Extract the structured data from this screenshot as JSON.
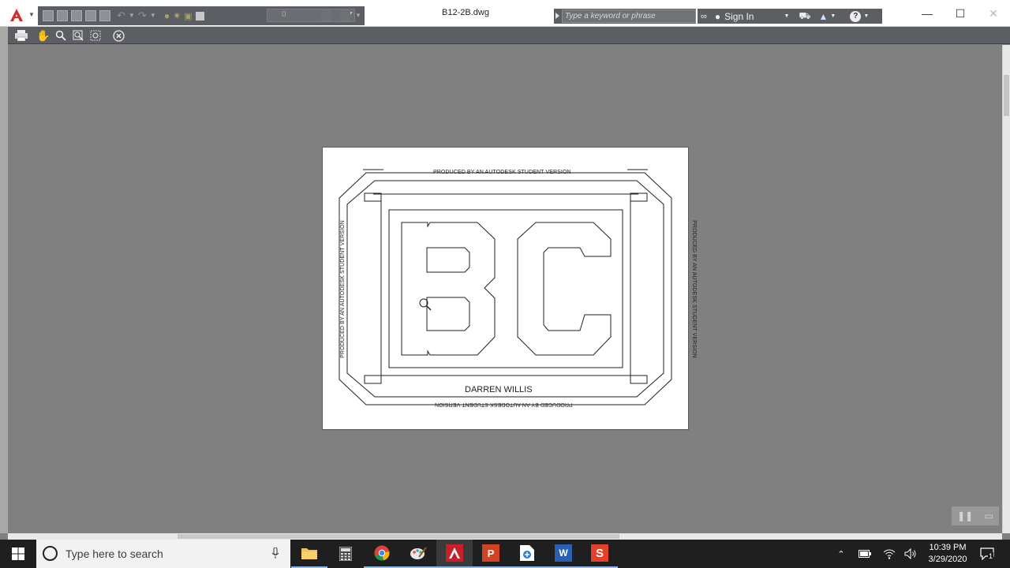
{
  "titlebar": {
    "filename": "B12-2B.dwg",
    "search_placeholder": "Type a keyword or phrase",
    "sign_in": "Sign In",
    "layer_value": "0"
  },
  "window_controls": {
    "minimize": "—",
    "maximize": "☐",
    "close": "✕"
  },
  "drawing": {
    "stamp_text": "PRODUCED BY AN AUTODESK STUDENT VERSION",
    "name": "DARREN WILLIS",
    "letters": "BC"
  },
  "taskbar": {
    "search_placeholder": "Type here to search",
    "time": "10:39 PM",
    "date": "3/29/2020",
    "notification_count": "1",
    "apps": [
      {
        "name": "File Explorer",
        "icon": "folder-icon"
      },
      {
        "name": "Calculator",
        "icon": "calculator-icon"
      },
      {
        "name": "Google Chrome",
        "icon": "chrome-icon"
      },
      {
        "name": "Paint",
        "icon": "paint-icon"
      },
      {
        "name": "AutoCAD",
        "icon": "autocad-icon"
      },
      {
        "name": "PowerPoint",
        "icon": "powerpoint-icon"
      },
      {
        "name": "Network Drive",
        "icon": "drive-icon"
      },
      {
        "name": "Word",
        "icon": "word-icon"
      },
      {
        "name": "Screencast",
        "icon": "screencast-icon"
      }
    ]
  },
  "colors": {
    "canvas": "#808080",
    "toolbar_dark": "#5b5e63",
    "autocad_red": "#d62b2b",
    "taskbar": "#1f1f1f"
  }
}
